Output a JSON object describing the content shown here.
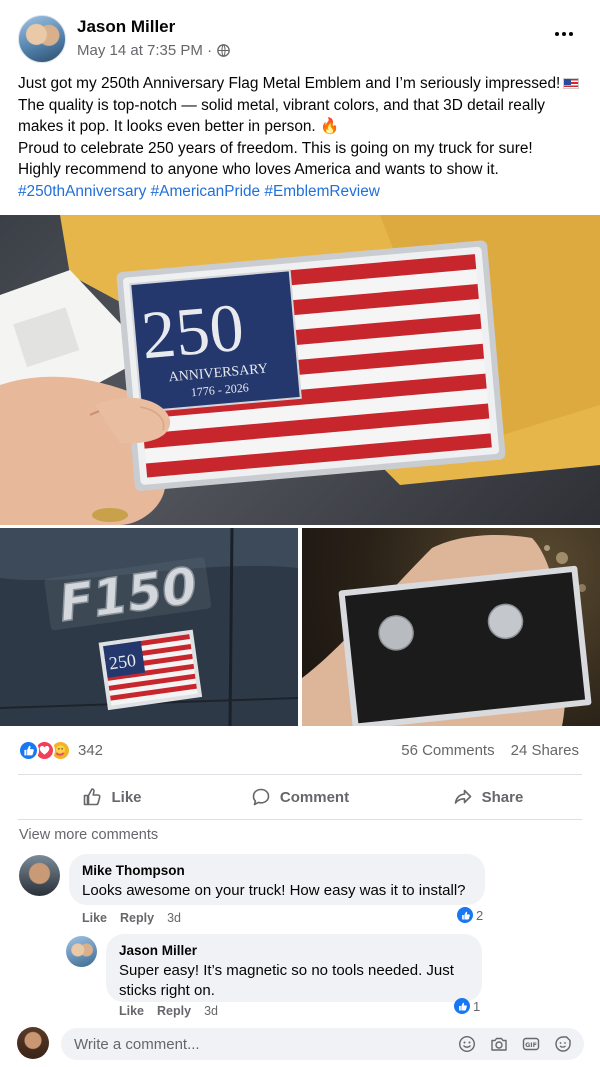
{
  "post": {
    "author": "Jason Miller",
    "timestamp": "May 14 at 7:35 PM ·",
    "privacy_icon": "globe-icon",
    "text_lines": [
      "Just got my 250th Anniversary Flag Metal Emblem and I’m seriously impressed!",
      "The quality is top-notch — solid metal, vibrant colors, and that 3D detail really",
      "makes it pop. It looks even better in person.",
      "Proud to celebrate 250 years of freedom. This is going on my truck for sure!",
      "Highly recommend to anyone who loves America and wants to show it."
    ],
    "hashtags": [
      "#250thAnniversary",
      "#AmericanPride",
      "#EmblemReview"
    ],
    "emblem": {
      "number": "250",
      "word": "ANNIVERSARY",
      "years": "1776 - 2026"
    },
    "badge_text": "F150"
  },
  "reactions": {
    "count": "342",
    "types": [
      "like",
      "love",
      "care"
    ],
    "comments": "56 Comments",
    "shares": "24 Shares"
  },
  "actions": {
    "like": "Like",
    "comment": "Comment",
    "share": "Share"
  },
  "view_more": "View more comments",
  "comments": [
    {
      "name": "Mike Thompson",
      "text": "Looks awesome on your truck! How easy was it to install?",
      "like": "Like",
      "reply": "Reply",
      "time": "3d",
      "reactions": "2"
    },
    {
      "name": "Jason Miller",
      "text_lines": [
        "Super easy! It’s magnetic so no tools needed. Just",
        "sticks right on."
      ],
      "like": "Like",
      "reply": "Reply",
      "time": "3d",
      "reactions": "1"
    }
  ],
  "writer": {
    "placeholder": "Write a comment...",
    "icons": [
      "emoji-icon",
      "camera-icon",
      "gif-icon",
      "sticker-icon"
    ]
  },
  "colors": {
    "link": "#216fdb",
    "like_blue": "#1877f2",
    "love_red": "#f33e58",
    "care_yellow": "#f7b125",
    "flag_red": "#c8262d",
    "flag_blue": "#24386e"
  }
}
